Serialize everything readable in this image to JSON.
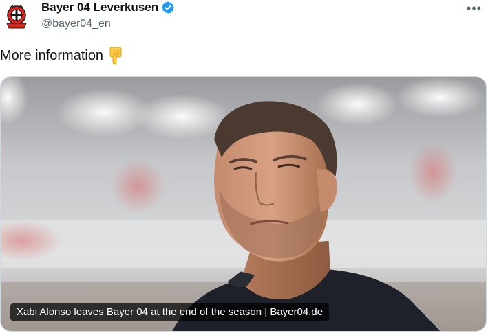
{
  "account": {
    "display_name": "Bayer 04 Leverkusen",
    "handle": "@bayer04_en",
    "verified": true,
    "avatar_icon": "bayer-leverkusen-crest-icon"
  },
  "tweet": {
    "text": "More information",
    "emoji_icon": "backhand-index-pointing-down-icon"
  },
  "menu": {
    "more_label": "•••"
  },
  "card": {
    "caption": "Xabi Alonso leaves Bayer 04 at the end of the season | Bayer04.de"
  },
  "colors": {
    "verified_blue": "#1d9bf0",
    "crest_red": "#e32219",
    "text_primary": "#0f1419",
    "text_secondary": "#536471"
  }
}
